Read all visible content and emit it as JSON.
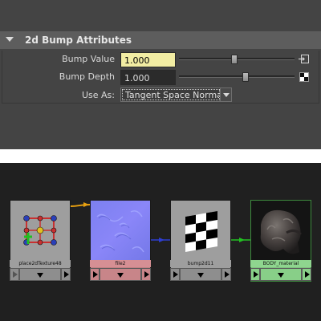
{
  "attribute_editor": {
    "section_title": "2d Bump Attributes",
    "bump_value": {
      "label": "Bump Value",
      "value": "1.000",
      "slider_fraction": 0.48
    },
    "bump_depth": {
      "label": "Bump Depth",
      "value": "1.000",
      "slider_fraction": 0.58
    },
    "use_as": {
      "label": "Use As:",
      "value": "Tangent Space Normals"
    }
  },
  "node_editor": {
    "nodes": [
      {
        "id": "place2d",
        "label": "place2dTexture48",
        "icon": "place2d-texture-icon"
      },
      {
        "id": "file",
        "label": "file2",
        "icon": "normal-map-swatch"
      },
      {
        "id": "bump",
        "label": "bump2d11",
        "icon": "bump-checker-swatch"
      },
      {
        "id": "material",
        "label": "BODY_material",
        "icon": "material-sphere-swatch"
      }
    ],
    "connections": [
      {
        "from": "place2dTexture48",
        "to": "file2",
        "color": "#e8a010"
      },
      {
        "from": "file2",
        "to": "bump2d11",
        "color": "#2e3ecf"
      },
      {
        "from": "bump2d11",
        "to": "BODY_material",
        "color": "#22c022"
      }
    ]
  },
  "colors": {
    "bump_value_field": "#f2eda3",
    "file_node": "#c07e82",
    "material_node": "#7fbf7f",
    "texture_node": "#9e9e9e"
  }
}
